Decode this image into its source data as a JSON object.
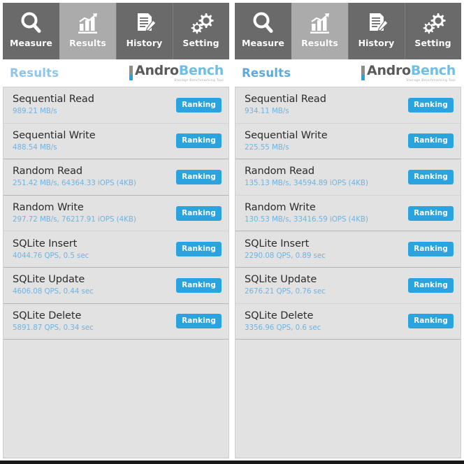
{
  "tabs": [
    {
      "id": "measure",
      "label": "Measure",
      "icon": "magnifier-icon",
      "active": false
    },
    {
      "id": "results",
      "label": "Results",
      "icon": "bar-chart-icon",
      "active": true
    },
    {
      "id": "history",
      "label": "History",
      "icon": "document-pencil-icon",
      "active": false
    },
    {
      "id": "setting",
      "label": "Setting",
      "icon": "gears-icon",
      "active": false
    }
  ],
  "logo": {
    "name_part1": "Andro",
    "name_part2": "Bench",
    "tagline": "Storage Benchmarking Tool"
  },
  "colors": {
    "accent_blue": "#2ba3de",
    "value_blue": "#6fb4e0",
    "tab_inactive": "#6a6a6a",
    "tab_active": "#ababab",
    "list_bg": "#e2e2e2"
  },
  "panels": [
    {
      "id": "left-panel",
      "header_title": "Results",
      "ranking_label": "Ranking",
      "rows": [
        {
          "title": "Sequential Read",
          "value": "989.21 MB/s",
          "group_end": false
        },
        {
          "title": "Sequential Write",
          "value": "488.54 MB/s",
          "group_end": true
        },
        {
          "title": "Random Read",
          "value": "251.42 MB/s, 64364.33 iOPS (4KB)",
          "group_end": true
        },
        {
          "title": "Random Write",
          "value": "297.72 MB/s, 76217.91 iOPS (4KB)",
          "group_end": false
        },
        {
          "title": "SQLite Insert",
          "value": "4044.76 QPS, 0.5 sec",
          "group_end": true
        },
        {
          "title": "SQLite Update",
          "value": "4606.08 QPS, 0.44 sec",
          "group_end": true
        },
        {
          "title": "SQLite Delete",
          "value": "5891.87 QPS, 0.34 sec",
          "group_end": true
        }
      ]
    },
    {
      "id": "right-panel",
      "header_title": "Results",
      "ranking_label": "Ranking",
      "rows": [
        {
          "title": "Sequential Read",
          "value": "934.11 MB/s",
          "group_end": false
        },
        {
          "title": "Sequential Write",
          "value": "225.55 MB/s",
          "group_end": true
        },
        {
          "title": "Random Read",
          "value": "135.13 MB/s, 34594.89 iOPS (4KB)",
          "group_end": false
        },
        {
          "title": "Random Write",
          "value": "130.53 MB/s, 33416.59 iOPS (4KB)",
          "group_end": true
        },
        {
          "title": "SQLite Insert",
          "value": "2290.08 QPS, 0.89 sec",
          "group_end": true
        },
        {
          "title": "SQLite Update",
          "value": "2676.21 QPS, 0.76 sec",
          "group_end": false
        },
        {
          "title": "SQLite Delete",
          "value": "3356.96 QPS, 0.6 sec",
          "group_end": true
        }
      ]
    }
  ]
}
